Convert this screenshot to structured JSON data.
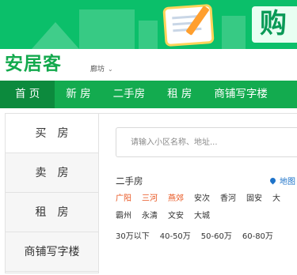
{
  "banner": {
    "headline_char": "购"
  },
  "header": {
    "logo": "安居客",
    "city": "廊坊"
  },
  "nav": {
    "items": [
      "首 页",
      "新 房",
      "二手房",
      "租 房",
      "商铺写字楼"
    ]
  },
  "side": {
    "tabs": [
      "买　房",
      "卖　房",
      "租　房",
      "商铺写字楼"
    ]
  },
  "search": {
    "placeholder": "请输入小区名称、地址..."
  },
  "section": {
    "title": "二手房",
    "map_label": "地图"
  },
  "districts": {
    "highlighted": [
      "广阳",
      "三河",
      "燕郊"
    ],
    "row1_more": [
      "安次",
      "香河",
      "固安",
      "大"
    ],
    "row2": [
      "霸州",
      "永清",
      "文安",
      "大城"
    ]
  },
  "prices": [
    "30万以下",
    "40-50万",
    "50-60万",
    "60-80万"
  ],
  "colors": {
    "brand_green": "#13ab4f",
    "nav_active": "#0c8a3d",
    "highlight_red": "#e8541e",
    "link_blue": "#1e73c9"
  }
}
